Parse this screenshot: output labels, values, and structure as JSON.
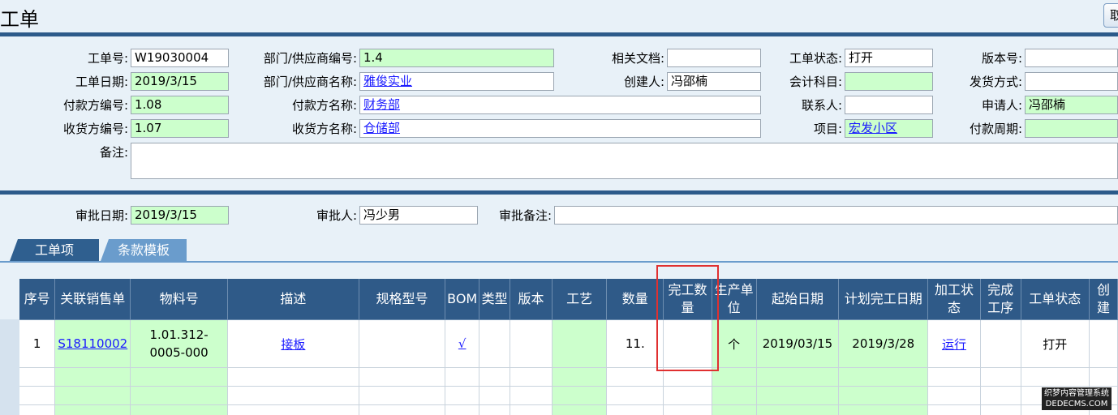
{
  "header": {
    "title": "工单",
    "top_button": "取"
  },
  "form": {
    "order_no_label": "工单号:",
    "order_no": "W19030004",
    "order_date_label": "工单日期:",
    "order_date": "2019/3/15",
    "payer_no_label": "付款方编号:",
    "payer_no": "1.08",
    "receiver_no_label": "收货方编号:",
    "receiver_no": "1.07",
    "remark_label": "备注:",
    "remark": "",
    "dept_no_label": "部门/供应商编号:",
    "dept_no": "1.4",
    "dept_name_label": "部门/供应商名称:",
    "dept_name": "雅俊实业",
    "payer_name_label": "付款方名称:",
    "payer_name": "财务部",
    "receiver_name_label": "收货方名称:",
    "receiver_name": "仓储部",
    "docs_label": "相关文档:",
    "docs": "",
    "creator_label": "创建人:",
    "creator": "冯邵楠",
    "status_label": "工单状态:",
    "status": "打开",
    "account_label": "会计科目:",
    "account": "",
    "contact_label": "联系人:",
    "contact": "",
    "project_label": "项目:",
    "project": "宏发小区",
    "version_label": "版本号:",
    "version": "",
    "ship_label": "发货方式:",
    "ship": "",
    "applicant_label": "申请人:",
    "applicant": "冯邵楠",
    "pay_period_label": "付款周期:",
    "pay_period": ""
  },
  "approval": {
    "date_label": "审批日期:",
    "date": "2019/3/15",
    "approver_label": "审批人:",
    "approver": "冯少男",
    "note_label": "审批备注:",
    "note": ""
  },
  "tabs": [
    {
      "label": "工单项"
    },
    {
      "label": "条款模板"
    }
  ],
  "table": {
    "headers": [
      "序号",
      "关联销售单",
      "物料号",
      "描述",
      "规格型号",
      "BOM",
      "类型",
      "版本",
      "工艺",
      "数量",
      "完工数量",
      "生产单位",
      "起始日期",
      "计划完工日期",
      "加工状态",
      "完成工序",
      "工单状态",
      "创建"
    ],
    "row1": [
      "1",
      "S18110002",
      "1.01.312-0005-000",
      "接板",
      "",
      "√",
      "",
      "",
      "",
      "11.",
      "",
      "个",
      "2019/03/15",
      "2019/3/28",
      "运行",
      "",
      "打开",
      ""
    ]
  },
  "watermark": {
    "line1": "织梦内容管理系统",
    "line2": "DEDECMS.COM"
  }
}
